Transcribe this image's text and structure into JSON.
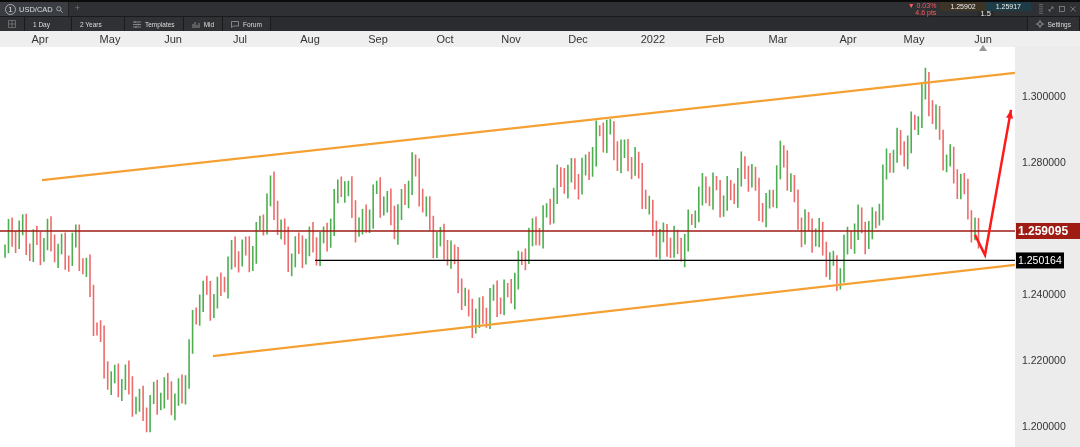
{
  "tab": {
    "badge": "1",
    "symbol": "USD/CAD",
    "add": "+"
  },
  "quote": {
    "change": "▼ 0.03%",
    "change_pts": "4.6 pts",
    "sell": "1.25902",
    "buy": "1.25917",
    "spread": "1.5"
  },
  "toolbar": {
    "interval": "1 Day",
    "range": "2 Years",
    "items": [
      {
        "kind": "templates",
        "label": "Templates"
      },
      {
        "kind": "mid",
        "label": "Mid"
      },
      {
        "kind": "forum",
        "label": "Forum"
      }
    ],
    "settings": "Settings"
  },
  "chart": {
    "time_labels": [
      "Apr",
      "May",
      "Jun",
      "Jul",
      "Aug",
      "Sep",
      "Oct",
      "Nov",
      "Dec",
      "2022",
      "Feb",
      "Mar",
      "Apr",
      "May",
      "Jun"
    ],
    "price_ticks": [
      "1.300000",
      "1.280000",
      "1.240000",
      "1.220000",
      "1.200000"
    ],
    "price_labels": [
      {
        "text": "1.259095",
        "color": "#9e1c14"
      },
      {
        "text": "1.250164",
        "color": "#000000"
      }
    ]
  }
}
